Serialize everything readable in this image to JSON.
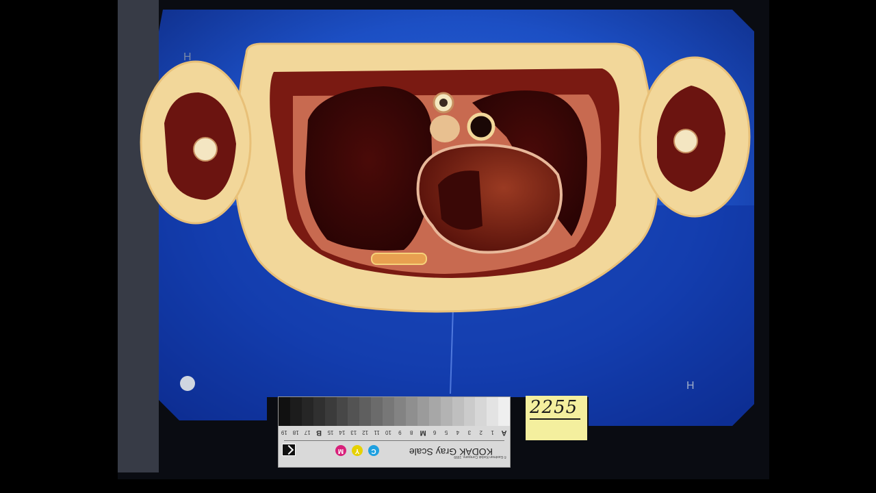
{
  "specimen_label": "2255",
  "gray_scale_card": {
    "title": "KODAK Gray Scale",
    "copyright": "© Eastman Kodak Company, 1999",
    "patch_labels": [
      "A",
      "1",
      "2",
      "3",
      "4",
      "5",
      "6",
      "M",
      "8",
      "9",
      "10",
      "11",
      "12",
      "13",
      "14",
      "15",
      "B",
      "17",
      "18",
      "19"
    ],
    "color_patches": [
      "C",
      "Y",
      "M"
    ]
  },
  "colors": {
    "background": "#000000",
    "gel": "#1a56c8",
    "fat": "#f2d79a",
    "tissue": "#6b1410"
  }
}
